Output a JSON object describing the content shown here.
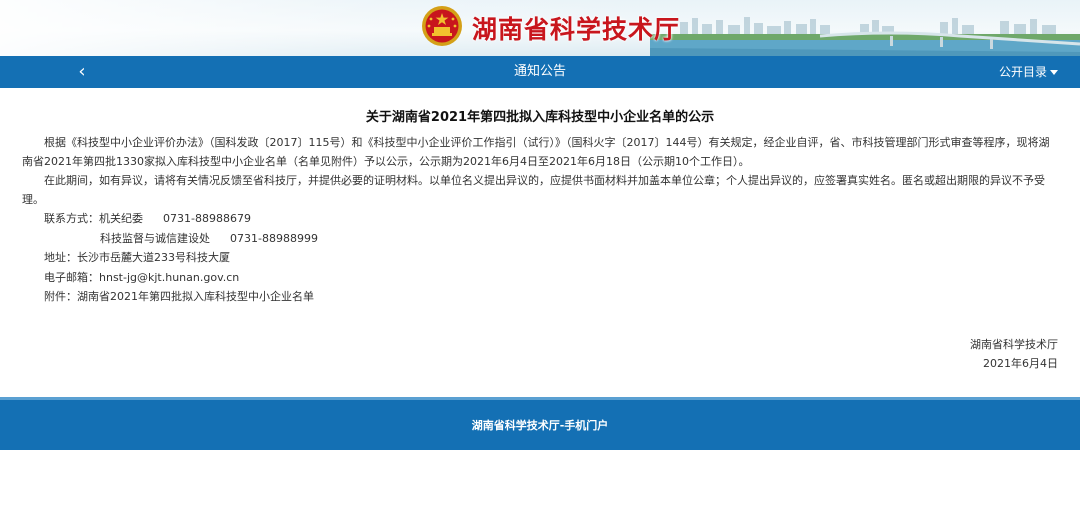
{
  "header": {
    "site_name": "湖南省科学技术厅"
  },
  "navbar": {
    "back_icon": "‹",
    "title": "通知公告",
    "menu_label": "公开目录"
  },
  "article": {
    "title": "关于湖南省2021年第四批拟入库科技型中小企业名单的公示",
    "paragraph1": "根据《科技型中小企业评价办法》（国科发政〔2017〕115号）和《科技型中小企业评价工作指引（试行）》（国科火字〔2017〕144号）有关规定，经企业自评，省、市科技管理部门形式审查等程序，现将湖南省2021年第四批1330家拟入库科技型中小企业名单（名单见附件）予以公示，公示期为2021年6月4日至2021年6月18日（公示期10个工作日）。",
    "paragraph2": "在此期间，如有异议，请将有关情况反馈至省科技厅，并提供必要的证明材料。以单位名义提出异议的，应提供书面材料并加盖本单位公章；个人提出异议的，应签署真实姓名。匿名或超出期限的异议不予受理。",
    "contact_label": "联系方式：",
    "contact1_dept": "机关纪委",
    "contact1_phone": "0731-88988679",
    "contact2_dept": "科技监督与诚信建设处",
    "contact2_phone": "0731-88988999",
    "address": "地址：长沙市岳麓大道233号科技大厦",
    "email": "电子邮箱：hnst-jg@kjt.hunan.gov.cn",
    "attachment": "附件：湖南省2021年第四批拟入库科技型中小企业名单",
    "signature_org": "湖南省科学技术厅",
    "signature_date": "2021年6月4日"
  },
  "footer": {
    "text": "湖南省科学技术厅-手机门户"
  },
  "colors": {
    "nav_blue": "#1470b4",
    "brand_red": "#c8161d"
  }
}
